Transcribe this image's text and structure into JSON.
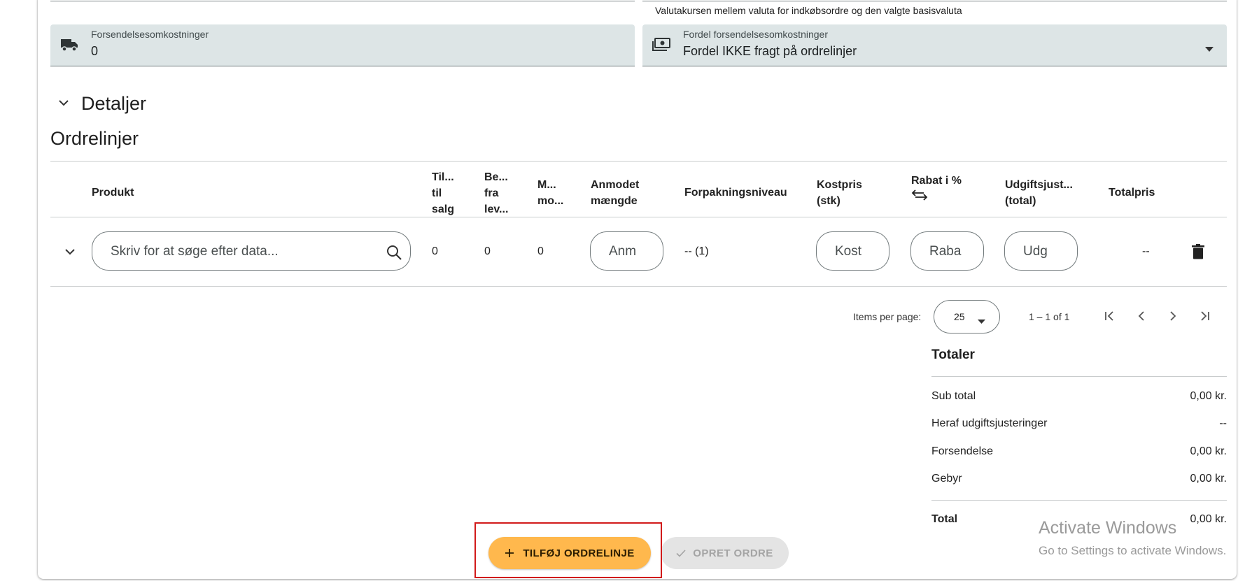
{
  "exchange_rate_hint": "Valutakursen mellem valuta for indkøbsordre og den valgte basisvaluta",
  "shipping_costs": {
    "label": "Forsendelsesomkostninger",
    "value": "0",
    "icon": "truck-icon"
  },
  "shipping_distribution": {
    "label": "Fordel forsendelsesomkostninger",
    "value": "Fordel IKKE fragt på ordrelinjer",
    "icon": "money-icon"
  },
  "details": {
    "label": "Detaljer"
  },
  "order_lines": {
    "title": "Ordrelinjer",
    "headers": {
      "product": "Produkt",
      "available": [
        "Til...",
        "til",
        "salg"
      ],
      "ordered": [
        "Be...",
        "fra",
        "lev..."
      ],
      "min": [
        "M...",
        "mo..."
      ],
      "requested": [
        "Anmodet",
        "mængde"
      ],
      "packaging": "Forpakningsniveau",
      "cost": [
        "Kostpris",
        "(stk)"
      ],
      "discount": "Rabat i %",
      "adjust": [
        "Udgiftsjust...",
        "(total)"
      ],
      "total": "Totalpris"
    },
    "row": {
      "search_placeholder": "Skriv for at søge efter data...",
      "available": "0",
      "ordered": "0",
      "min": "0",
      "requested_placeholder": "Anm",
      "packaging": "-- (1)",
      "cost_placeholder": "Kost",
      "discount_placeholder": "Raba",
      "adjust_placeholder": "Udg",
      "total": "--"
    }
  },
  "pagination": {
    "items_per_page_label": "Items per page:",
    "page_size": "25",
    "range": "1 – 1 of 1"
  },
  "totals": {
    "title": "Totaler",
    "rows": [
      {
        "label": "Sub total",
        "value": "0,00 kr."
      },
      {
        "label": "Heraf udgiftsjusteringer",
        "value": "--"
      },
      {
        "label": "Forsendelse",
        "value": "0,00 kr."
      },
      {
        "label": "Gebyr",
        "value": "0,00 kr."
      }
    ],
    "total_label": "Total",
    "total_value": "0,00 kr."
  },
  "buttons": {
    "add_line": "TILFØJ ORDRELINJE",
    "create_order": "OPRET ORDRE"
  },
  "windows_watermark": {
    "line1": "Activate Windows",
    "line2": "Go to Settings to activate Windows."
  },
  "colors": {
    "field_bg": "#dde5e6",
    "accent_button": "#ffb84d",
    "disabled_button": "#e4e4e4",
    "highlight_border": "#d11a1a"
  }
}
